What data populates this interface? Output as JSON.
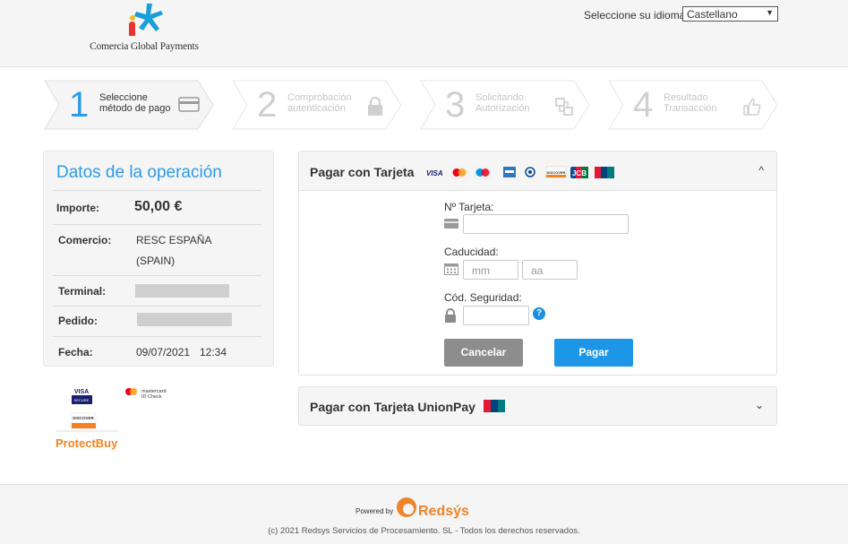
{
  "header": {
    "brand_name": "Comercia Global Payments",
    "language_label": "Seleccione su idioma",
    "language_selected": "Castellano"
  },
  "steps": [
    {
      "number": "1",
      "line1": "Seleccione",
      "line2": "método de pago",
      "active": true,
      "icon": "card-icon"
    },
    {
      "number": "2",
      "line1": "Comprobación",
      "line2": "autenticación",
      "active": false,
      "icon": "lock-icon"
    },
    {
      "number": "3",
      "line1": "Solicitando",
      "line2": "Autorización",
      "active": false,
      "icon": "exchange-icon"
    },
    {
      "number": "4",
      "line1": "Resultado",
      "line2": "Transacción",
      "active": false,
      "icon": "thumbs-up-icon"
    }
  ],
  "operation": {
    "title": "Datos de la operación",
    "amount_label": "Importe:",
    "amount_value": "50,00 €",
    "merchant_label": "Comercio:",
    "merchant_line1": "RESC ESPAÑA",
    "merchant_line2": "(SPAIN)",
    "terminal_label": "Terminal:",
    "order_label": "Pedido:",
    "date_label": "Fecha:",
    "date_value": "09/07/2021",
    "time_value": "12:34"
  },
  "secure_logos": {
    "visa": "VISA",
    "visa_sub": "SECURE",
    "mastercard": "mastercard",
    "mastercard_sub": "ID Check",
    "discover": "DISCOVER",
    "protectbuy": "ProtectBuy"
  },
  "card_payment": {
    "title": "Pagar con Tarjeta",
    "brand_visa": "VISA",
    "brand_jcb": "JCB",
    "brand_discover": "DISCOVER",
    "card_number_label": "Nº Tarjeta:",
    "card_number_value": "",
    "expiry_label": "Caducidad:",
    "month_placeholder": "mm",
    "year_placeholder": "aa",
    "cvv_label": "Cód. Seguridad:",
    "cvv_value": "",
    "help_symbol": "?",
    "cancel_label": "Cancelar",
    "pay_label": "Pagar"
  },
  "unionpay": {
    "title": "Pagar con Tarjeta UnionPay"
  },
  "footer": {
    "powered_by": "Powered by",
    "brand": "Redsýs",
    "copyright": "(c) 2021 Redsys Servicios de Procesamiento. SL - Todos los derechos reservados."
  },
  "colors": {
    "accent": "#2c9ce8",
    "pay_button": "#1e96e8",
    "cancel_button": "#8d8d8d",
    "redsys_orange": "#f0842a"
  }
}
